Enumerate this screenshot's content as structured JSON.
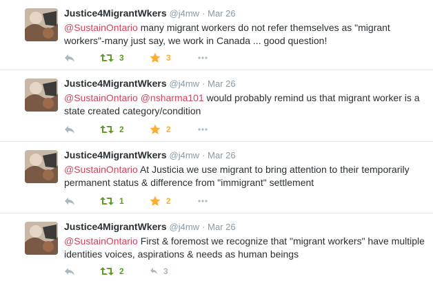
{
  "colors": {
    "mention": "#d0435a",
    "retweet": "#609928",
    "favorite": "#ffac33",
    "muted": "#8899a6"
  },
  "tweets": [
    {
      "name": "Justice4MigrantWkers",
      "handle": "@j4mw",
      "sep": "·",
      "time": "Mar 26",
      "mention1": "@SustainOntario",
      "mention2": "",
      "text": " many migrant workers do not refer themselves as \"migrant workers\"-many just say, we work in Canada ... good question!",
      "retweets": "3",
      "favorites": "3"
    },
    {
      "name": "Justice4MigrantWkers",
      "handle": "@j4mw",
      "sep": "·",
      "time": "Mar 26",
      "mention1": "@SustainOntario",
      "mention2": " @nsharma101",
      "text": " would probably remind us that migrant worker is a state created category/condition",
      "retweets": "2",
      "favorites": "2"
    },
    {
      "name": "Justice4MigrantWkers",
      "handle": "@j4mw",
      "sep": "·",
      "time": "Mar 26",
      "mention1": "@SustainOntario",
      "mention2": "",
      "text": " At Justicia we use migrant to bring attention to their temporarily permanent status & difference from \"immigrant\" settlement",
      "retweets": "1",
      "favorites": "2"
    },
    {
      "name": "Justice4MigrantWkers",
      "handle": "@j4mw",
      "sep": "·",
      "time": "Mar 26",
      "mention1": "@SustainOntario",
      "mention2": "",
      "text": " First & foremost we recognize that \"migrant workers\" have multiple identities voices, aspirations & needs as human beings",
      "retweets": "2",
      "favorites": "3",
      "favorite_empty": true
    }
  ]
}
